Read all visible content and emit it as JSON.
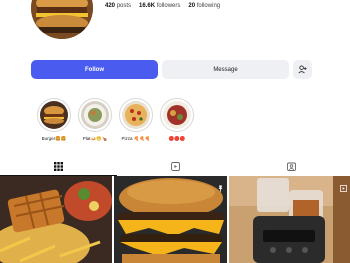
{
  "profile": {
    "posts_count": "420",
    "posts_label": "posts",
    "followers_count": "16.6K",
    "followers_label": "followers",
    "following_count": "20",
    "following_label": "following"
  },
  "actions": {
    "follow_label": "Follow",
    "message_label": "Message",
    "add_user_icon": "add-user-icon"
  },
  "highlights": [
    {
      "label": "Burger🍔🍔"
    },
    {
      "label": "Plat🍛😁🍗"
    },
    {
      "label": "Pizza 🍕🍕🍕"
    },
    {
      "label": "🔴🔴🔴"
    }
  ],
  "tabs": [
    {
      "icon": "grid-icon",
      "active": true
    },
    {
      "icon": "reels-icon",
      "active": false
    },
    {
      "icon": "tagged-icon",
      "active": false
    }
  ],
  "posts": [
    {
      "subject": "waffle fries plate",
      "badge": "none"
    },
    {
      "subject": "double cheeseburger",
      "badge": "pin-icon"
    },
    {
      "subject": "fryer appliance",
      "badge": "reel-icon"
    }
  ],
  "colors": {
    "accent": "#4a5cf0",
    "button_bg": "#eef0f4"
  }
}
